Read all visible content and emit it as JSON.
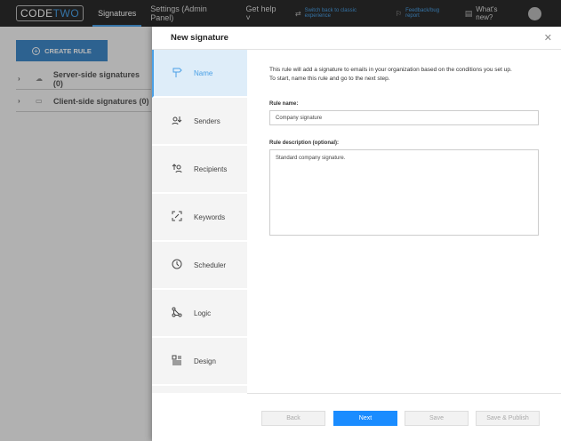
{
  "topbar": {
    "logo_main": "CODE",
    "logo_accent": "TWO",
    "tabs": [
      {
        "label": "Signatures"
      },
      {
        "label": "Settings (Admin Panel)"
      },
      {
        "label": "Get help ˅"
      }
    ],
    "switch_link": "Switch back to classic experience",
    "feedback_link": "Feedback/bug report",
    "whats_new": "What's new?"
  },
  "background": {
    "create_rule_label": "CREATE RULE",
    "tree": [
      {
        "label": "Server-side signatures (0)"
      },
      {
        "label": "Client-side signatures (0)"
      }
    ]
  },
  "modal": {
    "title": "New signature",
    "close_glyph": "✕",
    "steps": [
      {
        "label": "Name",
        "icon": "signpost-icon"
      },
      {
        "label": "Senders",
        "icon": "sender-icon"
      },
      {
        "label": "Recipients",
        "icon": "recipient-icon"
      },
      {
        "label": "Keywords",
        "icon": "keyword-icon"
      },
      {
        "label": "Scheduler",
        "icon": "clock-icon"
      },
      {
        "label": "Logic",
        "icon": "logic-icon"
      },
      {
        "label": "Design",
        "icon": "design-icon"
      }
    ],
    "intro_line1": "This rule will add a signature to emails in your organization based on the conditions you set up.",
    "intro_line2": "To start, name this rule and go to the next step.",
    "rule_name_label": "Rule name:",
    "rule_name_value": "Company signature",
    "rule_desc_label": "Rule description (optional):",
    "rule_desc_value": "Standard company signature.",
    "buttons": {
      "back": "Back",
      "next": "Next",
      "save": "Save",
      "save_publish": "Save & Publish"
    }
  },
  "colors": {
    "accent": "#4aa0e6",
    "primary_button": "#1a8cff",
    "topbar": "#2b2b2b"
  }
}
